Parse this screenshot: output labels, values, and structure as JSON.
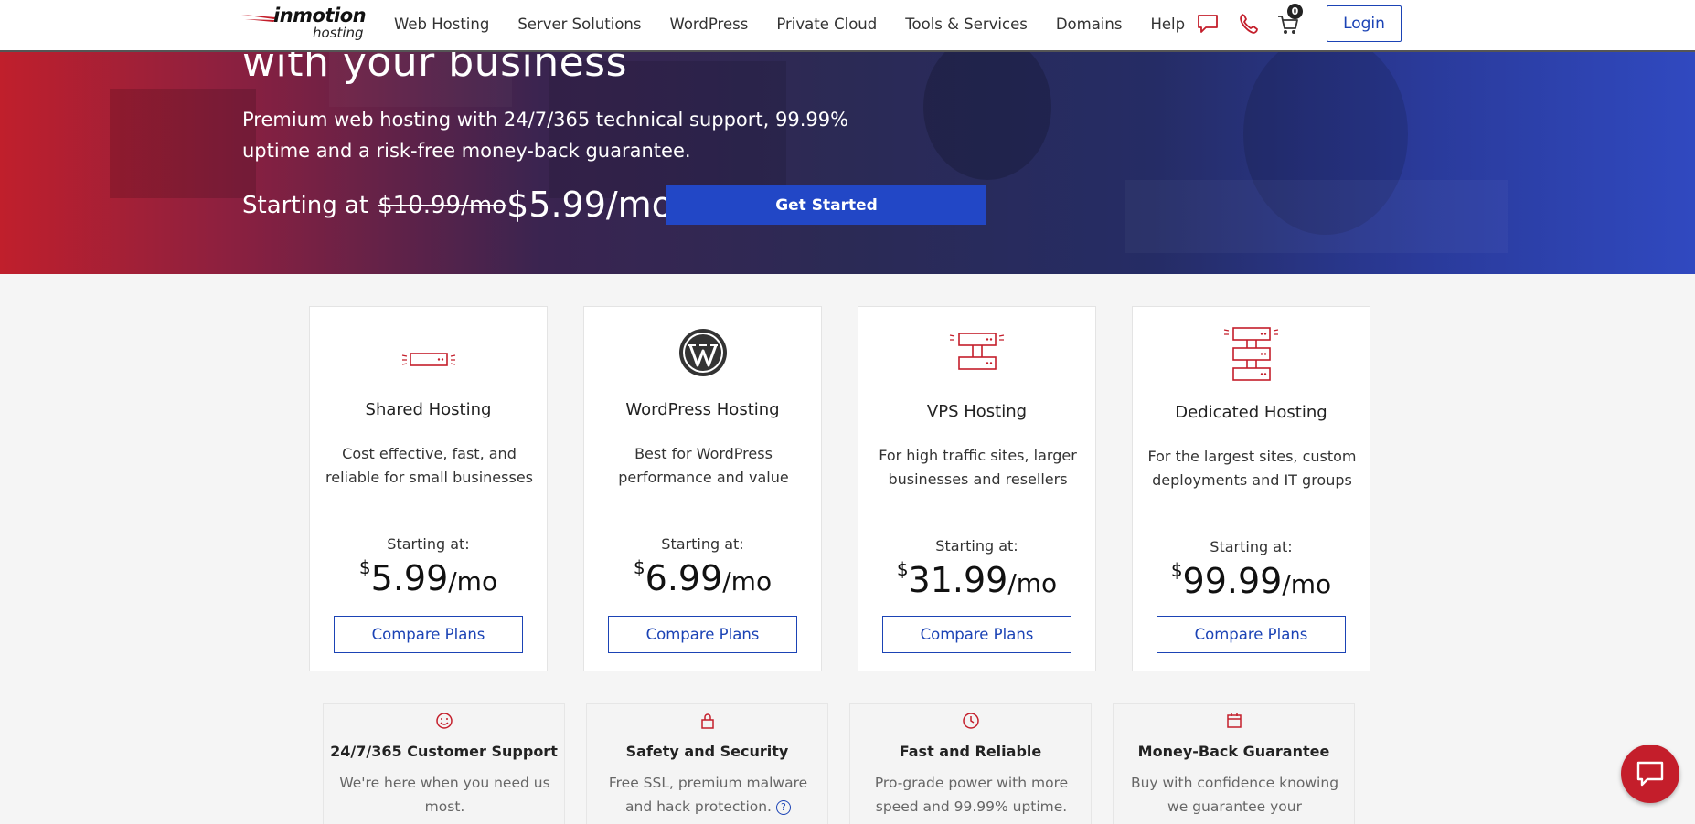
{
  "header": {
    "logo_word": "inmotion",
    "logo_sub": "hosting",
    "nav": [
      "Web Hosting",
      "Server Solutions",
      "WordPress",
      "Private Cloud",
      "Tools & Services",
      "Domains",
      "Help"
    ],
    "cart_count": "0",
    "login_label": "Login",
    "icons": [
      "chat-bubble-icon",
      "phone-icon",
      "cart-icon"
    ]
  },
  "hero": {
    "heading": "with your business",
    "subheading": "Premium web hosting with 24/7/365 technical support, 99.99% uptime and a risk-free money-back guarantee.",
    "price_prefix": "Starting at",
    "price_old": "$10.99/mo",
    "price_new": "$5.99/mo",
    "cta_label": "Get Started"
  },
  "plans": [
    {
      "title": "Shared Hosting",
      "desc": "Cost effective, fast, and reliable for small businesses",
      "start": "Starting at:",
      "currency": "$",
      "amount": "5.99",
      "per": "/mo",
      "cta": "Compare Plans",
      "icon": "server-icon"
    },
    {
      "title": "WordPress Hosting",
      "desc": "Best for WordPress performance and value",
      "start": "Starting at:",
      "currency": "$",
      "amount": "6.99",
      "per": "/mo",
      "cta": "Compare Plans",
      "icon": "wordpress-icon"
    },
    {
      "title": "VPS Hosting",
      "desc": "For high traffic sites, larger businesses and resellers",
      "start": "Starting at:",
      "currency": "$",
      "amount": "31.99",
      "per": "/mo",
      "cta": "Compare Plans",
      "icon": "vps-server-icon"
    },
    {
      "title": "Dedicated Hosting",
      "desc": "For the largest sites, custom deployments and IT groups",
      "start": "Starting at:",
      "currency": "$",
      "amount": "99.99",
      "per": "/mo",
      "cta": "Compare Plans",
      "icon": "dedicated-server-icon"
    }
  ],
  "features": [
    {
      "title": "24/7/365 Customer Support",
      "desc": "We're here when you need us most.",
      "icon": "smile-icon"
    },
    {
      "title": "Safety and Security",
      "desc": "Free SSL, premium malware and hack protection.",
      "icon": "lock-icon"
    },
    {
      "title": "Fast and Reliable",
      "desc": "Pro-grade power with more speed and 99.99% uptime.",
      "icon": "clock-icon"
    },
    {
      "title": "Money-Back Guarantee",
      "desc": "Buy with confidence knowing we guarantee your satisfaction.",
      "icon": "calendar-icon"
    }
  ],
  "colors": {
    "accent_red": "#c41e2b",
    "accent_blue": "#1b43b5",
    "cta_blue": "#2247c6"
  }
}
